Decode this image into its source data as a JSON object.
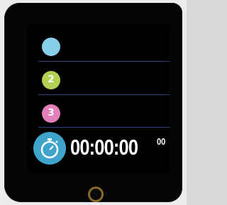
{
  "laps": [
    {
      "label": "",
      "color": "#86cfe9"
    },
    {
      "label": "2",
      "color": "#b5d153"
    },
    {
      "label": "3",
      "color": "#e37fba"
    }
  ],
  "timer": {
    "icon": "stopwatch-icon",
    "icon_color": "#3fa4cc",
    "main": "00:00:00",
    "fraction": "00"
  },
  "accent": {
    "divider": "#2f3f80"
  }
}
